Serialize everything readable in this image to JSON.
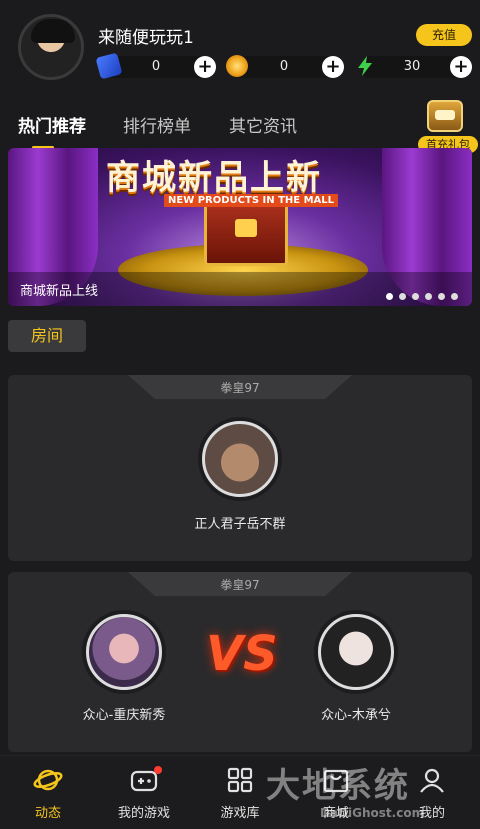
{
  "header": {
    "username": "来随便玩玩1",
    "recharge_label": "充值",
    "currencies": [
      {
        "icon": "card-ticket-icon",
        "value": "0"
      },
      {
        "icon": "gold-coin-icon",
        "value": "0"
      },
      {
        "icon": "lightning-energy-icon",
        "value": "30"
      }
    ],
    "plus_label": "+"
  },
  "tabs": [
    {
      "label": "热门推荐",
      "active": true
    },
    {
      "label": "排行榜单",
      "active": false
    },
    {
      "label": "其它资讯",
      "active": false
    }
  ],
  "gift": {
    "label": "首充礼包"
  },
  "banner": {
    "title": "商城新品上新",
    "subtitle": "NEW PRODUCTS IN THE MALL",
    "caption": "商城新品上线",
    "dot_count": 6,
    "active_dot": 0
  },
  "section": {
    "label": "房间"
  },
  "rooms": [
    {
      "game": "拳皇97",
      "players": [
        "正人君子岳不群"
      ]
    },
    {
      "game": "拳皇97",
      "players": [
        "众心-重庆新秀",
        "众心-木承兮"
      ],
      "vs_label": "VS"
    }
  ],
  "nav": [
    {
      "label": "动态",
      "icon": "planet-icon",
      "active": true
    },
    {
      "label": "我的游戏",
      "icon": "gamepad-icon",
      "active": false,
      "badge": true
    },
    {
      "label": "游戏库",
      "icon": "grid-icon",
      "active": false
    },
    {
      "label": "商城",
      "icon": "store-icon",
      "active": false
    },
    {
      "label": "我的",
      "icon": "profile-icon",
      "active": false
    }
  ],
  "watermark": {
    "text": "大地系统",
    "sub": "DaDiGhost.com"
  },
  "colors": {
    "accent": "#f6c51c",
    "background": "#1b1b1d",
    "card": "#2a2a2c",
    "badge": "#ff3b30"
  }
}
